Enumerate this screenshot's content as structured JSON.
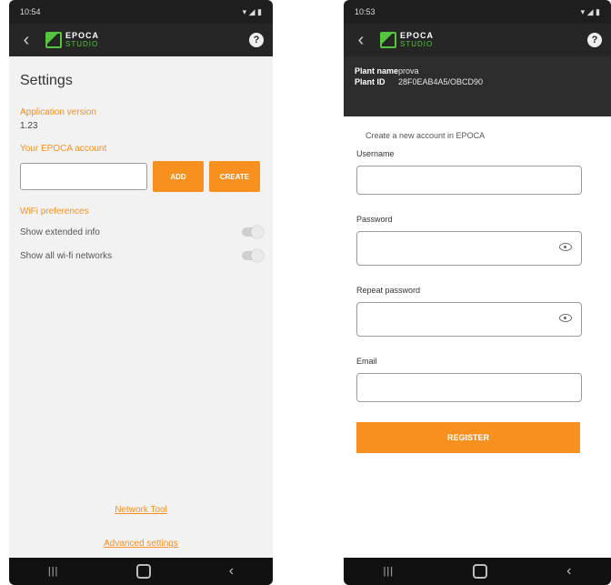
{
  "left": {
    "status": {
      "time": "10:54",
      "right": "▾ ◢ ▮"
    },
    "logo": {
      "word1": "EPOCA",
      "word2": "STUDIO"
    },
    "title": "Settings",
    "app_version_label": "Application version",
    "app_version_value": "1.23",
    "account_label": "Your EPOCA account",
    "add_button": "ADD",
    "create_button": "CREATE",
    "wifi_label": "WiFi preferences",
    "toggle1_label": "Show extended info",
    "toggle2_label": "Show all wi-fi networks",
    "network_tool": "Network Tool",
    "advanced_settings": "Advanced settings"
  },
  "right": {
    "status": {
      "time": "10:53",
      "right": "▾ ◢ ▮"
    },
    "logo": {
      "word1": "EPOCA",
      "word2": "STUDIO"
    },
    "plant_name_label": "Plant name",
    "plant_name_value": "prova",
    "plant_id_label": "Plant ID",
    "plant_id_value": "28F0EAB4A5/OBCD90",
    "intro": "Create a new account in EPOCA",
    "username_label": "Username",
    "password_label": "Password",
    "repeat_password_label": "Repeat password",
    "email_label": "Email",
    "register_button": "REGISTER"
  },
  "nav": {
    "recents": "|||",
    "back": "‹"
  },
  "help_icon": "?",
  "back_glyph": "‹",
  "colors": {
    "accent": "#f7901e",
    "appbar": "#262626",
    "logo_green": "#55c43f"
  }
}
